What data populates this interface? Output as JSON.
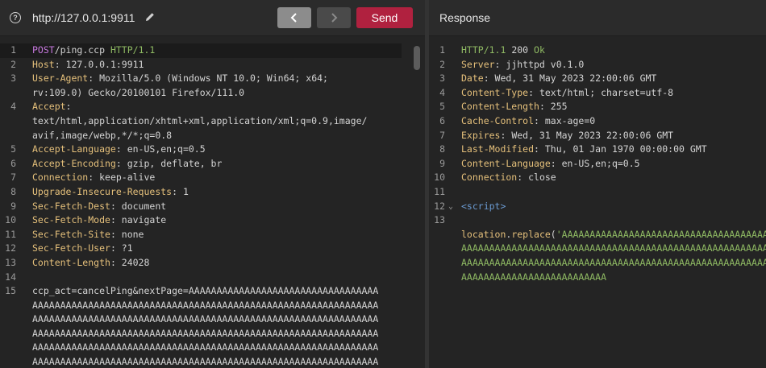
{
  "request": {
    "url": "http://127.0.0.1:9911",
    "send_label": "Send",
    "lines": [
      {
        "n": "1",
        "parts": [
          [
            "m",
            "POST"
          ],
          [
            "",
            "/ping.ccp "
          ],
          [
            "g",
            "HTTP/1.1"
          ]
        ],
        "current": true
      },
      {
        "n": "2",
        "parts": [
          [
            "k",
            "Host"
          ],
          [
            "",
            ": 127.0.0.1:9911"
          ]
        ]
      },
      {
        "n": "3",
        "parts": [
          [
            "k",
            "User-Agent"
          ],
          [
            "",
            ": Mozilla/5.0 (Windows NT 10.0; Win64; x64;"
          ]
        ]
      },
      {
        "n": "",
        "parts": [
          [
            "",
            "rv:109.0) Gecko/20100101 Firefox/111.0"
          ]
        ]
      },
      {
        "n": "4",
        "parts": [
          [
            "k",
            "Accept"
          ],
          [
            "",
            ":"
          ]
        ]
      },
      {
        "n": "",
        "parts": [
          [
            "",
            "text/html,application/xhtml+xml,application/xml;q=0.9,image/"
          ]
        ]
      },
      {
        "n": "",
        "parts": [
          [
            "",
            "avif,image/webp,*/*;q=0.8"
          ]
        ]
      },
      {
        "n": "5",
        "parts": [
          [
            "k",
            "Accept-Language"
          ],
          [
            "",
            ": en-US,en;q=0.5"
          ]
        ]
      },
      {
        "n": "6",
        "parts": [
          [
            "k",
            "Accept-Encoding"
          ],
          [
            "",
            ": gzip, deflate, br"
          ]
        ]
      },
      {
        "n": "7",
        "parts": [
          [
            "k",
            "Connection"
          ],
          [
            "",
            ": keep-alive"
          ]
        ]
      },
      {
        "n": "8",
        "parts": [
          [
            "k",
            "Upgrade-Insecure-Requests"
          ],
          [
            "",
            ": 1"
          ]
        ]
      },
      {
        "n": "9",
        "parts": [
          [
            "k",
            "Sec-Fetch-Dest"
          ],
          [
            "",
            ": document"
          ]
        ]
      },
      {
        "n": "10",
        "parts": [
          [
            "k",
            "Sec-Fetch-Mode"
          ],
          [
            "",
            ": navigate"
          ]
        ]
      },
      {
        "n": "11",
        "parts": [
          [
            "k",
            "Sec-Fetch-Site"
          ],
          [
            "",
            ": none"
          ]
        ]
      },
      {
        "n": "12",
        "parts": [
          [
            "k",
            "Sec-Fetch-User"
          ],
          [
            "",
            ": ?1"
          ]
        ]
      },
      {
        "n": "13",
        "parts": [
          [
            "k",
            "Content-Length"
          ],
          [
            "",
            ": 24028"
          ]
        ]
      },
      {
        "n": "14",
        "parts": []
      },
      {
        "n": "15",
        "parts": [
          [
            "",
            "ccp_act=cancelPing&nextPage=AAAAAAAAAAAAAAAAAAAAAAAAAAAAAAAAAA"
          ]
        ]
      },
      {
        "n": "",
        "parts": [
          [
            "",
            "AAAAAAAAAAAAAAAAAAAAAAAAAAAAAAAAAAAAAAAAAAAAAAAAAAAAAAAAAAAAAA"
          ]
        ]
      },
      {
        "n": "",
        "parts": [
          [
            "",
            "AAAAAAAAAAAAAAAAAAAAAAAAAAAAAAAAAAAAAAAAAAAAAAAAAAAAAAAAAAAAAA"
          ]
        ]
      },
      {
        "n": "",
        "parts": [
          [
            "",
            "AAAAAAAAAAAAAAAAAAAAAAAAAAAAAAAAAAAAAAAAAAAAAAAAAAAAAAAAAAAAAA"
          ]
        ]
      },
      {
        "n": "",
        "parts": [
          [
            "",
            "AAAAAAAAAAAAAAAAAAAAAAAAAAAAAAAAAAAAAAAAAAAAAAAAAAAAAAAAAAAAAA"
          ]
        ]
      },
      {
        "n": "",
        "parts": [
          [
            "",
            "AAAAAAAAAAAAAAAAAAAAAAAAAAAAAAAAAAAAAAAAAAAAAAAAAAAAAAAAAAAAAA"
          ]
        ]
      }
    ]
  },
  "response": {
    "title": "Response",
    "lines": [
      {
        "n": "1",
        "parts": [
          [
            "g",
            "HTTP/1.1 "
          ],
          [
            "",
            "200 "
          ],
          [
            "g",
            "Ok"
          ]
        ]
      },
      {
        "n": "2",
        "parts": [
          [
            "k",
            "Server"
          ],
          [
            "",
            ": jjhttpd v0.1.0"
          ]
        ]
      },
      {
        "n": "3",
        "parts": [
          [
            "k",
            "Date"
          ],
          [
            "",
            ": Wed, 31 May 2023 22:00:06 GMT"
          ]
        ]
      },
      {
        "n": "4",
        "parts": [
          [
            "k",
            "Content-Type"
          ],
          [
            "",
            ": text/html; charset=utf-8"
          ]
        ]
      },
      {
        "n": "5",
        "parts": [
          [
            "k",
            "Content-Length"
          ],
          [
            "",
            ": 255"
          ]
        ]
      },
      {
        "n": "6",
        "parts": [
          [
            "k",
            "Cache-Control"
          ],
          [
            "",
            ": max-age=0"
          ]
        ]
      },
      {
        "n": "7",
        "parts": [
          [
            "k",
            "Expires"
          ],
          [
            "",
            ": Wed, 31 May 2023 22:00:06 GMT"
          ]
        ]
      },
      {
        "n": "8",
        "parts": [
          [
            "k",
            "Last-Modified"
          ],
          [
            "",
            ": Thu, 01 Jan 1970 00:00:00 GMT"
          ]
        ]
      },
      {
        "n": "9",
        "parts": [
          [
            "k",
            "Content-Language"
          ],
          [
            "",
            ": en-US,en;q=0.5"
          ]
        ]
      },
      {
        "n": "10",
        "parts": [
          [
            "k",
            "Connection"
          ],
          [
            "",
            ": close"
          ]
        ]
      },
      {
        "n": "11",
        "parts": []
      },
      {
        "n": "12",
        "parts": [
          [
            "t",
            "<script>"
          ]
        ],
        "fold": "⌄"
      },
      {
        "n": "13",
        "parts": []
      },
      {
        "n": "",
        "parts": [
          [
            "k",
            "location"
          ],
          [
            "",
            "."
          ],
          [
            "k",
            "replace"
          ],
          [
            "",
            "("
          ],
          [
            "s",
            "'AAAAAAAAAAAAAAAAAAAAAAAAAAAAAAAAAAAAAAAAAAAAA"
          ]
        ]
      },
      {
        "n": "",
        "parts": [
          [
            "s",
            "AAAAAAAAAAAAAAAAAAAAAAAAAAAAAAAAAAAAAAAAAAAAAAAAAAAAAAAAAAAAAAAAAAAA"
          ]
        ]
      },
      {
        "n": "",
        "parts": [
          [
            "s",
            "AAAAAAAAAAAAAAAAAAAAAAAAAAAAAAAAAAAAAAAAAAAAAAAAAAAAAAAAAAAAAAAAAAAA"
          ]
        ]
      },
      {
        "n": "",
        "parts": [
          [
            "s",
            "AAAAAAAAAAAAAAAAAAAAAAAAAA"
          ]
        ]
      }
    ]
  }
}
